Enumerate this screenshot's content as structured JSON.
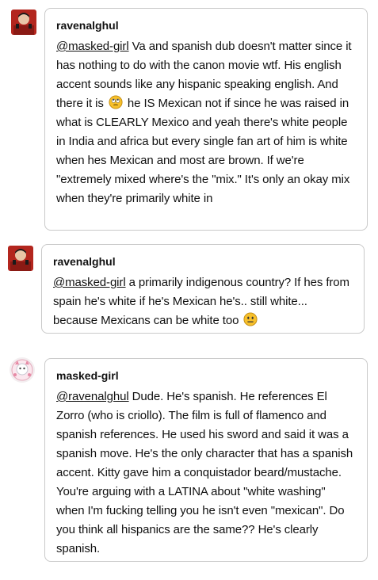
{
  "replies": [
    {
      "username": "ravenalghul",
      "mention": "@masked-girl",
      "segments": [
        " Va and spanish dub doesn't matter since it has nothing to do with the canon movie wtf. His english accent sounds like any hispanic speaking english. And there it is ",
        " he IS Mexican not if since he was raised in what is CLEARLY Mexico and yeah there's white people in India and africa but every single fan art of him is white when hes Mexican and most are brown. If we're \"extremely mixed where's the \"mix.\" It's only an okay mix when they're primarily white in"
      ],
      "emoji": "eye-roll-emoji"
    },
    {
      "username": "ravenalghul",
      "mention": "@masked-girl",
      "segments": [
        " a primarily indigenous country? If hes from spain he's white if he's Mexican he's.. still white... because Mexicans can be white too "
      ],
      "emoji": "neutral-face-emoji"
    },
    {
      "username": "masked-girl",
      "mention": "@ravenalghul",
      "segments": [
        " Dude. He's spanish. He references El Zorro (who is criollo). The film is full of flamenco and spanish references. He used his sword and said it was a spanish move. He's the only character that has a spanish accent. Kitty gave him a conquistador beard/mustache. You're arguing with a LATINA about \"white washing\" when I'm fucking telling you he isn't even \"mexican\". Do you think all hispanics are the same?? He's clearly spanish."
      ]
    }
  ],
  "colors": {
    "border": "#c9c9c9",
    "emoji": "#f7c02b",
    "avatar_red": "#b3261e"
  }
}
